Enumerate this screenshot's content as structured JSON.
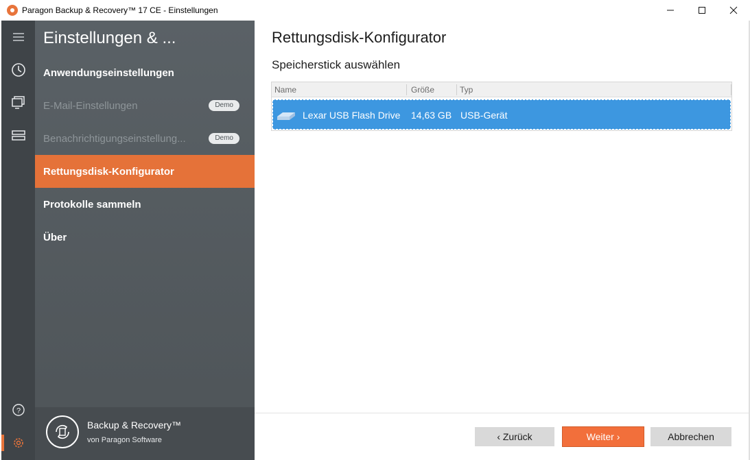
{
  "window": {
    "title": "Paragon Backup & Recovery™ 17 CE - Einstellungen"
  },
  "nav": {
    "title": "Einstellungen & ...",
    "items": [
      {
        "label": "Anwendungseinstellungen",
        "state": "normal"
      },
      {
        "label": "E-Mail-Einstellungen",
        "state": "disabled",
        "badge": "Demo"
      },
      {
        "label": "Benachrichtigungseinstellung...",
        "state": "disabled",
        "badge": "Demo"
      },
      {
        "label": "Rettungsdisk-Konfigurator",
        "state": "active"
      },
      {
        "label": "Protokolle sammeln",
        "state": "normal"
      },
      {
        "label": "Über",
        "state": "normal"
      }
    ],
    "footer": {
      "title": "Backup & Recovery™",
      "subtitle": "von Paragon Software"
    }
  },
  "rail": {
    "icons": [
      "menu-icon",
      "history-icon",
      "monitor-icon",
      "drives-icon",
      "help-icon",
      "gear-icon"
    ]
  },
  "content": {
    "title": "Rettungsdisk-Konfigurator",
    "section": "Speicherstick auswählen",
    "table": {
      "columns": [
        "Name",
        "Größe",
        "Typ"
      ],
      "rows": [
        {
          "name": "Lexar USB Flash Drive",
          "size": "14,63 GB",
          "type": "USB-Gerät",
          "selected": true
        }
      ]
    }
  },
  "buttons": {
    "back": "‹ Zurück",
    "next": "Weiter ›",
    "cancel": "Abbrechen"
  },
  "colors": {
    "accent": "#e57239",
    "selection": "#3d97e0",
    "nav_bg": "#53595d",
    "rail_bg": "#3f4448"
  }
}
